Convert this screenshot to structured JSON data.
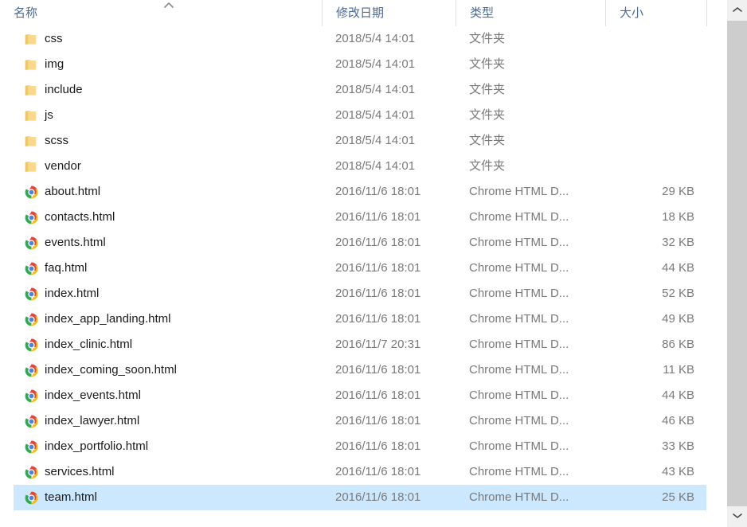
{
  "window": {
    "type": "file-explorer-list-view",
    "selection_color": "#cce8ff",
    "header_text_color": "#4a6a9a"
  },
  "header": {
    "columns": [
      {
        "key": "name",
        "label": "名称",
        "sorted": true,
        "sort_direction": "ascending"
      },
      {
        "key": "date",
        "label": "修改日期"
      },
      {
        "key": "type",
        "label": "类型"
      },
      {
        "key": "size",
        "label": "大小"
      }
    ],
    "sort_indicator_icon": "sort-ascending-caret-icon"
  },
  "items": [
    {
      "name": "css",
      "date": "2018/5/4 14:01",
      "type": "文件夹",
      "size": "",
      "icon": "folder-icon",
      "selected": false
    },
    {
      "name": "img",
      "date": "2018/5/4 14:01",
      "type": "文件夹",
      "size": "",
      "icon": "folder-icon",
      "selected": false
    },
    {
      "name": "include",
      "date": "2018/5/4 14:01",
      "type": "文件夹",
      "size": "",
      "icon": "folder-icon",
      "selected": false
    },
    {
      "name": "js",
      "date": "2018/5/4 14:01",
      "type": "文件夹",
      "size": "",
      "icon": "folder-icon",
      "selected": false
    },
    {
      "name": "scss",
      "date": "2018/5/4 14:01",
      "type": "文件夹",
      "size": "",
      "icon": "folder-icon",
      "selected": false
    },
    {
      "name": "vendor",
      "date": "2018/5/4 14:01",
      "type": "文件夹",
      "size": "",
      "icon": "folder-icon",
      "selected": false
    },
    {
      "name": "about.html",
      "date": "2016/11/6 18:01",
      "type": "Chrome HTML D...",
      "size": "29 KB",
      "icon": "chrome-html-document-icon",
      "selected": false
    },
    {
      "name": "contacts.html",
      "date": "2016/11/6 18:01",
      "type": "Chrome HTML D...",
      "size": "18 KB",
      "icon": "chrome-html-document-icon",
      "selected": false
    },
    {
      "name": "events.html",
      "date": "2016/11/6 18:01",
      "type": "Chrome HTML D...",
      "size": "32 KB",
      "icon": "chrome-html-document-icon",
      "selected": false
    },
    {
      "name": "faq.html",
      "date": "2016/11/6 18:01",
      "type": "Chrome HTML D...",
      "size": "44 KB",
      "icon": "chrome-html-document-icon",
      "selected": false
    },
    {
      "name": "index.html",
      "date": "2016/11/6 18:01",
      "type": "Chrome HTML D...",
      "size": "52 KB",
      "icon": "chrome-html-document-icon",
      "selected": false
    },
    {
      "name": "index_app_landing.html",
      "date": "2016/11/6 18:01",
      "type": "Chrome HTML D...",
      "size": "49 KB",
      "icon": "chrome-html-document-icon",
      "selected": false
    },
    {
      "name": "index_clinic.html",
      "date": "2016/11/7 20:31",
      "type": "Chrome HTML D...",
      "size": "86 KB",
      "icon": "chrome-html-document-icon",
      "selected": false
    },
    {
      "name": "index_coming_soon.html",
      "date": "2016/11/6 18:01",
      "type": "Chrome HTML D...",
      "size": "11 KB",
      "icon": "chrome-html-document-icon",
      "selected": false
    },
    {
      "name": "index_events.html",
      "date": "2016/11/6 18:01",
      "type": "Chrome HTML D...",
      "size": "44 KB",
      "icon": "chrome-html-document-icon",
      "selected": false
    },
    {
      "name": "index_lawyer.html",
      "date": "2016/11/6 18:01",
      "type": "Chrome HTML D...",
      "size": "46 KB",
      "icon": "chrome-html-document-icon",
      "selected": false
    },
    {
      "name": "index_portfolio.html",
      "date": "2016/11/6 18:01",
      "type": "Chrome HTML D...",
      "size": "33 KB",
      "icon": "chrome-html-document-icon",
      "selected": false
    },
    {
      "name": "services.html",
      "date": "2016/11/6 18:01",
      "type": "Chrome HTML D...",
      "size": "43 KB",
      "icon": "chrome-html-document-icon",
      "selected": false
    },
    {
      "name": "team.html",
      "date": "2016/11/6 18:01",
      "type": "Chrome HTML D...",
      "size": "25 KB",
      "icon": "chrome-html-document-icon",
      "selected": true
    }
  ],
  "scrollbar": {
    "up_icon": "chevron-up-icon",
    "down_icon": "chevron-down-icon",
    "thumb_color": "#cdcdcd",
    "track_color": "#f0f0f0"
  }
}
